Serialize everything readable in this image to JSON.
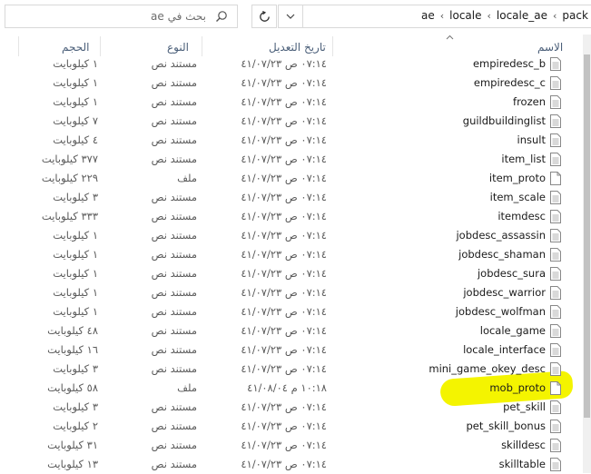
{
  "search": {
    "placeholder": "بحث في ae"
  },
  "address": {
    "crumbs": [
      "pack",
      "locale_ae",
      "locale",
      "ae"
    ]
  },
  "columns": {
    "name": "الاسم",
    "date": "تاريخ التعديل",
    "type": "النوع",
    "size": "الحجم"
  },
  "files": [
    {
      "name": "empiredesc_b",
      "date": "٠٧:١٤ ص ٤١/٠٧/٢٣",
      "type": "مستند نص",
      "size": "١ كيلوبايت"
    },
    {
      "name": "empiredesc_c",
      "date": "٠٧:١٤ ص ٤١/٠٧/٢٣",
      "type": "مستند نص",
      "size": "١ كيلوبايت"
    },
    {
      "name": "frozen",
      "date": "٠٧:١٤ ص ٤١/٠٧/٢٣",
      "type": "مستند نص",
      "size": "١ كيلوبايت"
    },
    {
      "name": "guildbuildinglist",
      "date": "٠٧:١٤ ص ٤١/٠٧/٢٣",
      "type": "مستند نص",
      "size": "٧ كيلوبايت"
    },
    {
      "name": "insult",
      "date": "٠٧:١٤ ص ٤١/٠٧/٢٣",
      "type": "مستند نص",
      "size": "٤ كيلوبايت"
    },
    {
      "name": "item_list",
      "date": "٠٧:١٤ ص ٤١/٠٧/٢٣",
      "type": "مستند نص",
      "size": "٣٧٧ كيلوبايت"
    },
    {
      "name": "item_proto",
      "date": "٠٧:١٤ ص ٤١/٠٧/٢٣",
      "type": "ملف",
      "size": "٢٢٩ كيلوبايت"
    },
    {
      "name": "item_scale",
      "date": "٠٧:١٤ ص ٤١/٠٧/٢٣",
      "type": "مستند نص",
      "size": "٣ كيلوبايت"
    },
    {
      "name": "itemdesc",
      "date": "٠٧:١٤ ص ٤١/٠٧/٢٣",
      "type": "مستند نص",
      "size": "٣٣٣ كيلوبايت"
    },
    {
      "name": "jobdesc_assassin",
      "date": "٠٧:١٤ ص ٤١/٠٧/٢٣",
      "type": "مستند نص",
      "size": "١ كيلوبايت"
    },
    {
      "name": "jobdesc_shaman",
      "date": "٠٧:١٤ ص ٤١/٠٧/٢٣",
      "type": "مستند نص",
      "size": "١ كيلوبايت"
    },
    {
      "name": "jobdesc_sura",
      "date": "٠٧:١٤ ص ٤١/٠٧/٢٣",
      "type": "مستند نص",
      "size": "١ كيلوبايت"
    },
    {
      "name": "jobdesc_warrior",
      "date": "٠٧:١٤ ص ٤١/٠٧/٢٣",
      "type": "مستند نص",
      "size": "١ كيلوبايت"
    },
    {
      "name": "jobdesc_wolfman",
      "date": "٠٧:١٤ ص ٤١/٠٧/٢٣",
      "type": "مستند نص",
      "size": "١ كيلوبايت"
    },
    {
      "name": "locale_game",
      "date": "٠٧:١٤ ص ٤١/٠٧/٢٣",
      "type": "مستند نص",
      "size": "٤٨ كيلوبايت"
    },
    {
      "name": "locale_interface",
      "date": "٠٧:١٤ ص ٤١/٠٧/٢٣",
      "type": "مستند نص",
      "size": "١٦ كيلوبايت"
    },
    {
      "name": "mini_game_okey_desc",
      "date": "٠٧:١٤ ص ٤١/٠٧/٢٣",
      "type": "مستند نص",
      "size": "٣ كيلوبايت"
    },
    {
      "name": "mob_proto",
      "date": "١٠:١٨ م ٤١/٠٨/٠٤",
      "type": "ملف",
      "size": "٥٨ كيلوبايت"
    },
    {
      "name": "pet_skill",
      "date": "٠٧:١٤ ص ٤١/٠٧/٢٣",
      "type": "مستند نص",
      "size": "٣ كيلوبايت"
    },
    {
      "name": "pet_skill_bonus",
      "date": "٠٧:١٤ ص ٤١/٠٧/٢٣",
      "type": "مستند نص",
      "size": "٢ كيلوبايت"
    },
    {
      "name": "skilldesc",
      "date": "٠٧:١٤ ص ٤١/٠٧/٢٣",
      "type": "مستند نص",
      "size": "٣١ كيلوبايت"
    },
    {
      "name": "skilltable",
      "date": "٠٧:١٤ ص ٤١/٠٧/٢٣",
      "type": "مستند نص",
      "size": "١٣ كيلوبايت"
    }
  ],
  "highlight_color": "#f4f400"
}
